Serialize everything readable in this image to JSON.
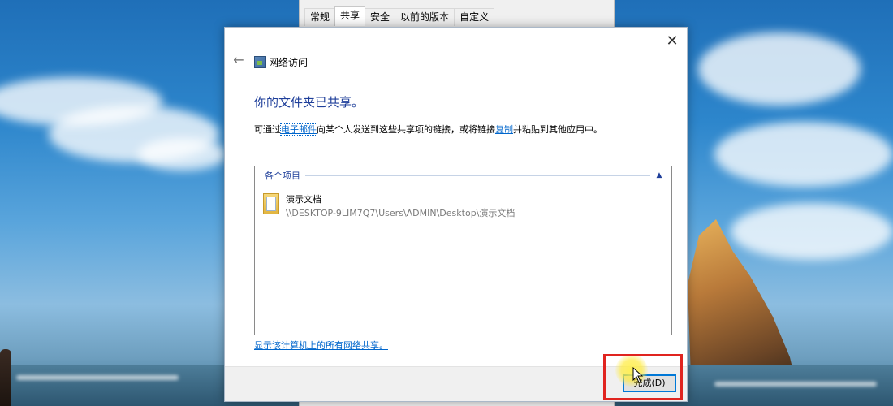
{
  "background_window": {
    "tabs": [
      "常规",
      "共享",
      "安全",
      "以前的版本",
      "自定义"
    ],
    "active_tab_index": 1
  },
  "dialog": {
    "title": "网络访问",
    "heading": "你的文件夹已共享。",
    "description": {
      "prefix": "可通过",
      "email_link": "电子邮件",
      "middle": "向某个人发送到这些共享项的链接，或将链接",
      "copy_link": "复制",
      "suffix": "并粘贴到其他应用中。"
    },
    "items_group": {
      "label": "各个项目",
      "items": [
        {
          "name": "演示文档",
          "path": "\\\\DESKTOP-9LIM7Q7\\Users\\ADMIN\\Desktop\\演示文档"
        }
      ]
    },
    "show_all_link": "显示该计算机上的所有网络共享。",
    "finish_button": "完成(D)",
    "close_glyph": "✕",
    "back_glyph": "←"
  },
  "colors": {
    "heading": "#1f3f9a",
    "link": "#0066cc",
    "highlight": "#e0241f",
    "button_focus": "#0078d7"
  }
}
